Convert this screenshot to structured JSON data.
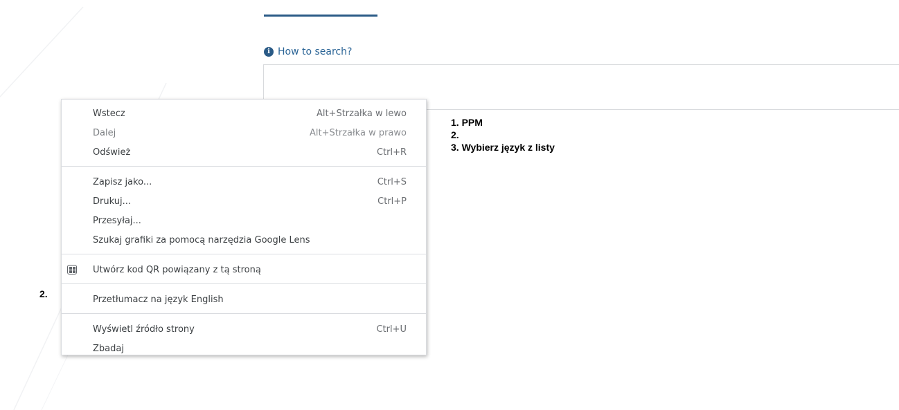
{
  "page": {
    "how_to_search": "How to search?",
    "info_icon_glyph": "i"
  },
  "instructions": {
    "line1": "1. PPM",
    "line2": "2.",
    "line3": "3. Wybierz język z listy",
    "side_marker": "2."
  },
  "context_menu": {
    "back": {
      "label": "Wstecz",
      "shortcut": "Alt+Strzałka w lewo"
    },
    "forward": {
      "label": "Dalej",
      "shortcut": "Alt+Strzałka w prawo"
    },
    "reload": {
      "label": "Odśwież",
      "shortcut": "Ctrl+R"
    },
    "save_as": {
      "label": "Zapisz jako...",
      "shortcut": "Ctrl+S"
    },
    "print": {
      "label": "Drukuj...",
      "shortcut": "Ctrl+P"
    },
    "cast": {
      "label": "Przesyłaj..."
    },
    "google_lens": {
      "label": "Szukaj grafiki za pomocą narzędzia Google Lens"
    },
    "qr_code": {
      "label": "Utwórz kod QR powiązany z tą stroną",
      "icon": "qr-code-icon"
    },
    "translate": {
      "label": "Przetłumacz na język English"
    },
    "view_source": {
      "label": "Wyświetl źródło strony",
      "shortcut": "Ctrl+U"
    },
    "inspect": {
      "label": "Zbadaj"
    }
  },
  "colors": {
    "accent": "#2a5a86",
    "link": "#2a6496"
  }
}
